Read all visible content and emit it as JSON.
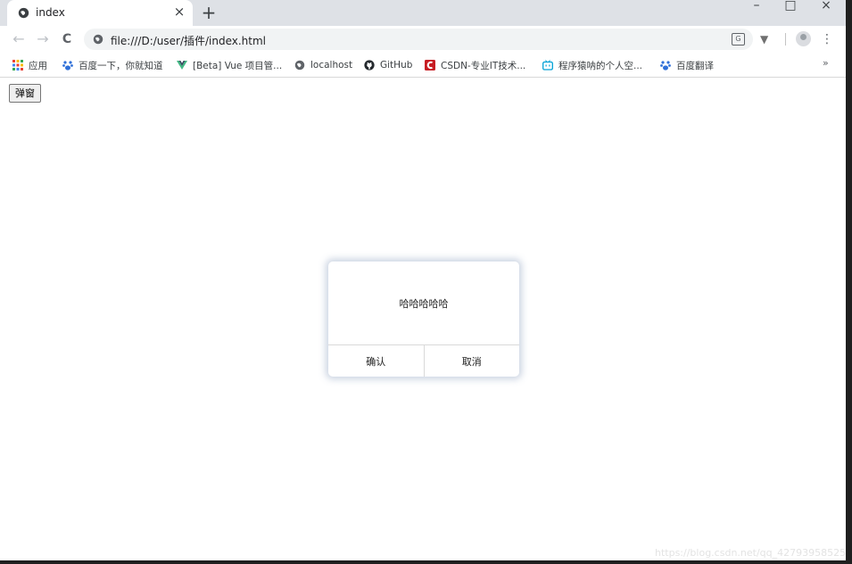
{
  "browser": {
    "tab": {
      "title": "index",
      "close_symbol": "×"
    },
    "new_tab_symbol": "+",
    "window_controls": {
      "minimize": "–",
      "maximize": "□",
      "close": "×"
    },
    "nav": {
      "back": "←",
      "forward": "→",
      "reload": "C"
    },
    "address": {
      "url": "file:///D:/user/插件/index.html"
    },
    "menu_symbol": "⋮"
  },
  "bookmarks": {
    "items": [
      {
        "label": "应用",
        "icon": "apps-grid-icon"
      },
      {
        "label": "百度一下，你就知道",
        "icon": "baidu-paw-icon"
      },
      {
        "label": "[Beta] Vue 项目管...",
        "icon": "vue-logo-icon"
      },
      {
        "label": "localhost",
        "icon": "globe-icon"
      },
      {
        "label": "GitHub",
        "icon": "github-icon"
      },
      {
        "label": "CSDN-专业IT技术...",
        "icon": "csdn-logo-icon"
      },
      {
        "label": "程序猿呐的个人空...",
        "icon": "bilibili-tv-icon"
      },
      {
        "label": "百度翻译",
        "icon": "baidu-paw-icon"
      }
    ],
    "overflow": "»"
  },
  "page": {
    "popup_button_label": "弹窗",
    "dialog": {
      "message": "哈哈哈哈哈",
      "confirm_label": "确认",
      "cancel_label": "取消"
    },
    "watermark": "https://blog.csdn.net/qq_42793958525"
  },
  "colors": {
    "tab_strip": "#dee1e6",
    "omnibox": "#f1f3f4",
    "vue_green": "#41b883",
    "csdn_red": "#c71d23",
    "bilibili_blue": "#00a1d6",
    "baidu_blue": "#2e6fd8"
  }
}
